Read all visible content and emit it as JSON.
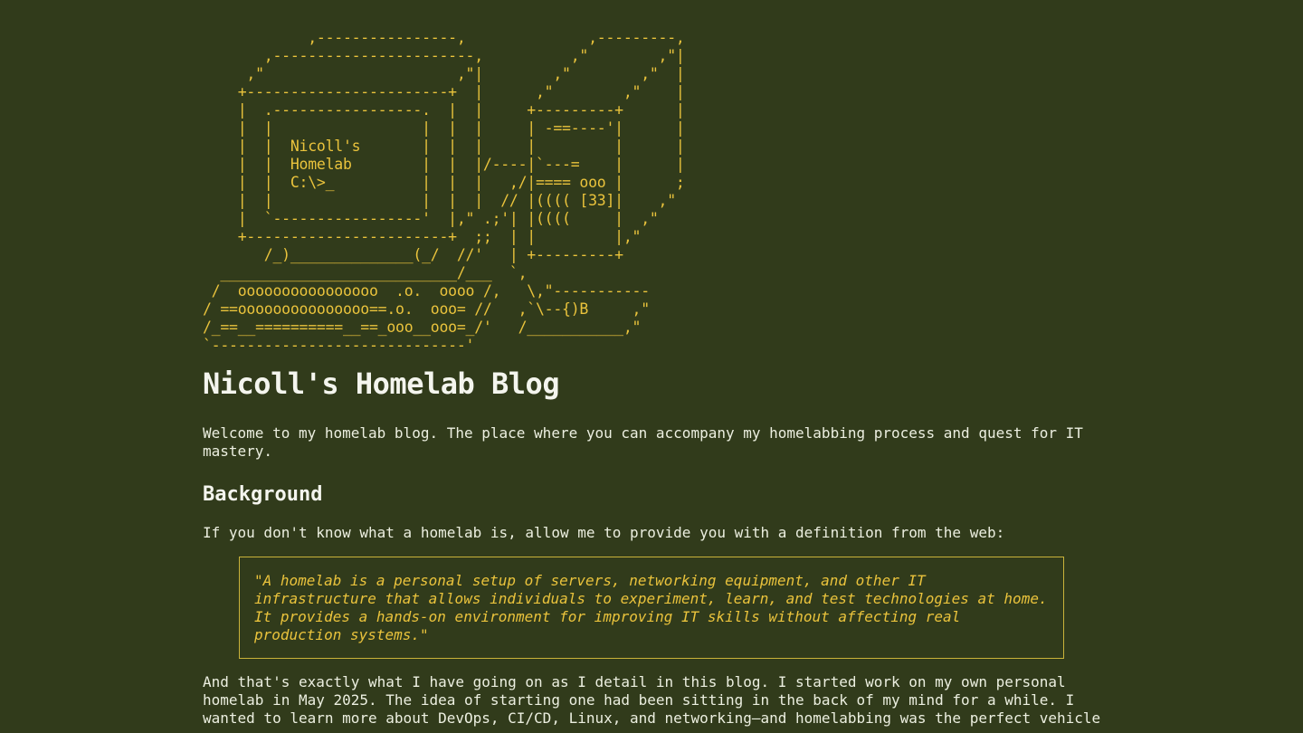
{
  "ascii_art": "            ,----------------,              ,---------,\n       ,-----------------------,          ,\"        ,\"|\n     ,\"                      ,\"|        ,\"        ,\"  |\n    +-----------------------+  |      ,\"        ,\"    |\n    |  .-----------------.  |  |     +---------+      |\n    |  |                 |  |  |     | -==----'|      |\n    |  |  Nicoll's       |  |  |     |         |      |\n    |  |  Homelab        |  |  |/----|`---=    |      |\n    |  |  C:\\>_          |  |  |   ,/|==== ooo |      ;\n    |  |                 |  |  |  // |(((( [33]|    ,\"\n    |  `-----------------'  |,\" .;'| |((((     |  ,\"\n    +-----------------------+  ;;  | |         |,\"\n       /_)______________(_/  //'   | +---------+\n  ___________________________/___  `,\n /  oooooooooooooooo  .o.  oooo /,   \\,\"-----------\n/ ==ooooooooooooooo==.o.  ooo= //   ,`\\--{)B     ,\"\n/_==__==========__==_ooo__ooo=_/'   /___________,\"\n`-----------------------------'",
  "title": "Nicoll's Homelab Blog",
  "intro": "Welcome to my homelab blog. The place where you can accompany my homelabbing process and quest for IT mastery.",
  "background": {
    "heading": "Background",
    "lead": "If you don't know what a homelab is, allow me to provide you with a definition from the web:",
    "quote": "\"A homelab is a personal setup of servers, networking equipment, and other IT infrastructure that allows individuals to experiment, learn, and test technologies at home. It provides a hands-on environment for improving IT skills without affecting real production systems.\"",
    "body": "And that's exactly what I have going on as I detail in this blog. I started work on my own personal homelab in May 2025. The idea of starting one had been sitting in the back of my mind for a while. I wanted to learn more about DevOps, CI/CD, Linux, and networking—and homelabbing was the perfect vehicle"
  },
  "colors": {
    "background": "#313b1b",
    "accent": "#eac33c",
    "text": "#ecefe0"
  }
}
